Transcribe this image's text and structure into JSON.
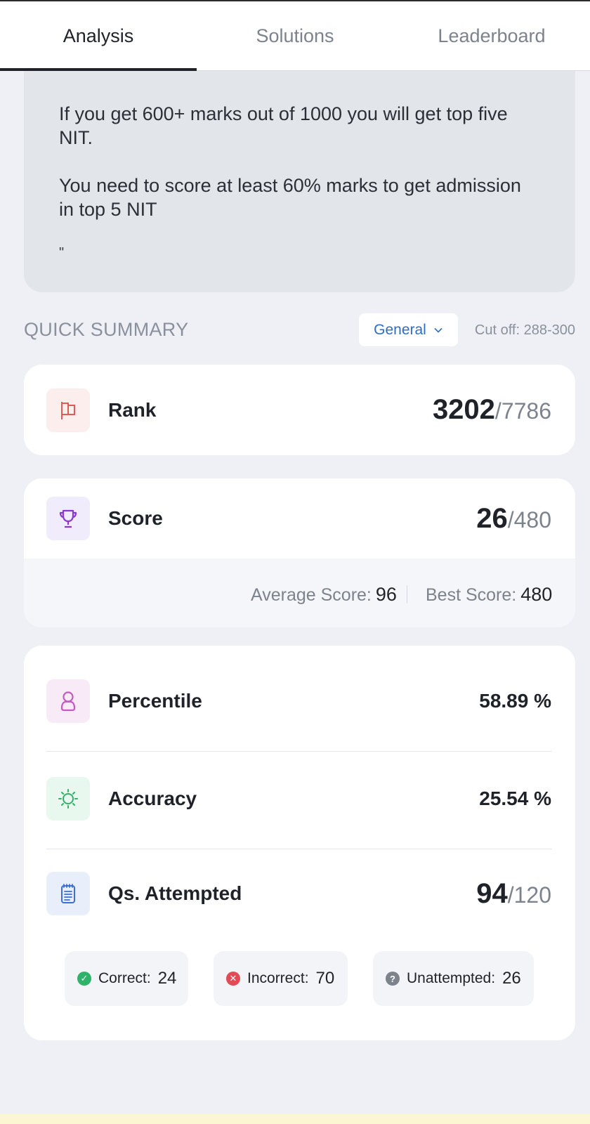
{
  "tabs": [
    {
      "label": "Analysis",
      "active": true
    },
    {
      "label": "Solutions",
      "active": false
    },
    {
      "label": "Leaderboard",
      "active": false
    }
  ],
  "note": {
    "line1": "If you get 600+ marks out of 1000 you will get top five NIT.",
    "line2": "You need to score at least 60% marks to get admission in top 5 NIT",
    "quote": "\""
  },
  "summary": {
    "title": "QUICK SUMMARY",
    "category": "General",
    "cutoff": "Cut off: 288-300"
  },
  "rank": {
    "label": "Rank",
    "value": "3202",
    "total": "/7786",
    "icon": "flag-icon"
  },
  "score": {
    "label": "Score",
    "value": "26",
    "total": "/480",
    "icon": "trophy-icon",
    "avg_label": "Average Score:",
    "avg_value": "96",
    "best_label": "Best Score:",
    "best_value": "480"
  },
  "percentile": {
    "label": "Percentile",
    "value": "58.89 %",
    "icon": "user-icon"
  },
  "accuracy": {
    "label": "Accuracy",
    "value": "25.54 %",
    "icon": "sun-icon"
  },
  "attempted": {
    "label": "Qs. Attempted",
    "value": "94",
    "total": "/120",
    "icon": "clipboard-icon"
  },
  "breakdown": {
    "correct_label": "Correct:",
    "correct_value": "24",
    "incorrect_label": "Incorrect:",
    "incorrect_value": "70",
    "unattempted_label": "Unattempted:",
    "unattempted_value": "26"
  },
  "colors": {
    "accent": "#2e6ec4",
    "correct": "#2fb26a",
    "incorrect": "#e24b55",
    "unattempted": "#7d838c"
  }
}
